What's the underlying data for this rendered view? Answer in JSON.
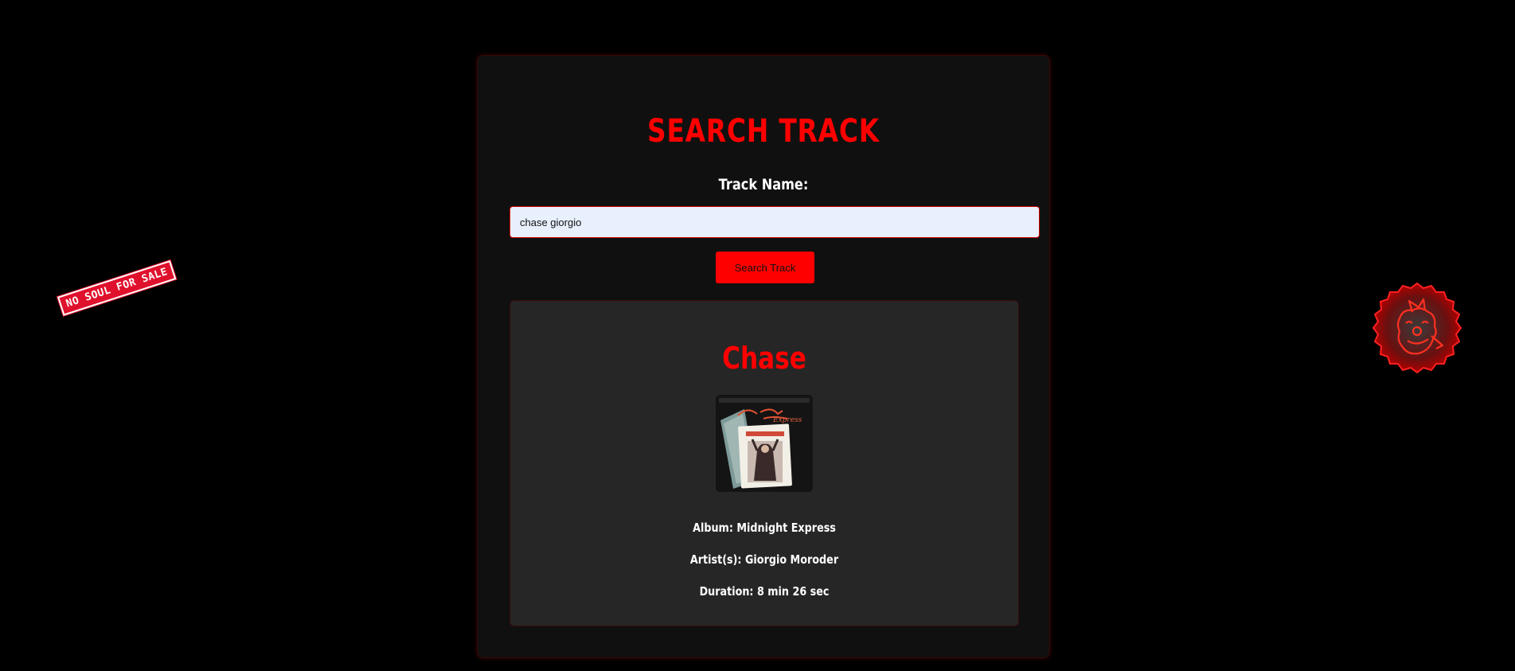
{
  "stickers": {
    "left_text": "NO SOUL FOR SALE",
    "right_icon": "clown-face-badge-icon"
  },
  "search": {
    "title": "SEARCH TRACK",
    "label": "Track Name:",
    "query": "chase giorgio",
    "button_label": "Search Track"
  },
  "result": {
    "track": "Chase",
    "cover_icon": "album-cover-image",
    "album": "Album: Midnight Express",
    "artists": "Artist(s): Giorgio Moroder",
    "duration": "Duration: 8 min 26 sec"
  },
  "colors": {
    "accent": "#ff0000",
    "background": "#000000",
    "panel": "#101010",
    "card": "#262626",
    "input_bg": "#e8f0fe"
  }
}
